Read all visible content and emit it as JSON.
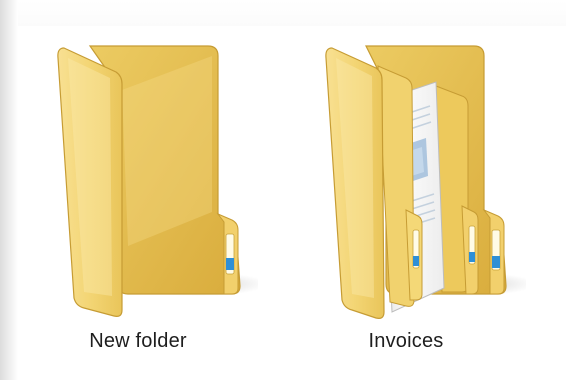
{
  "explorer": {
    "items": [
      {
        "label": "New folder",
        "icon": "empty-folder-icon"
      },
      {
        "label": "Invoices",
        "icon": "folder-with-documents-icon"
      }
    ]
  },
  "colors": {
    "folder_front": "#f4d67a",
    "folder_back": "#e8c050",
    "folder_edge": "#c9a23a",
    "tab_accent": "#2e8fd6",
    "paper": "#f7f7f7",
    "label_text": "#1e1e1e"
  }
}
